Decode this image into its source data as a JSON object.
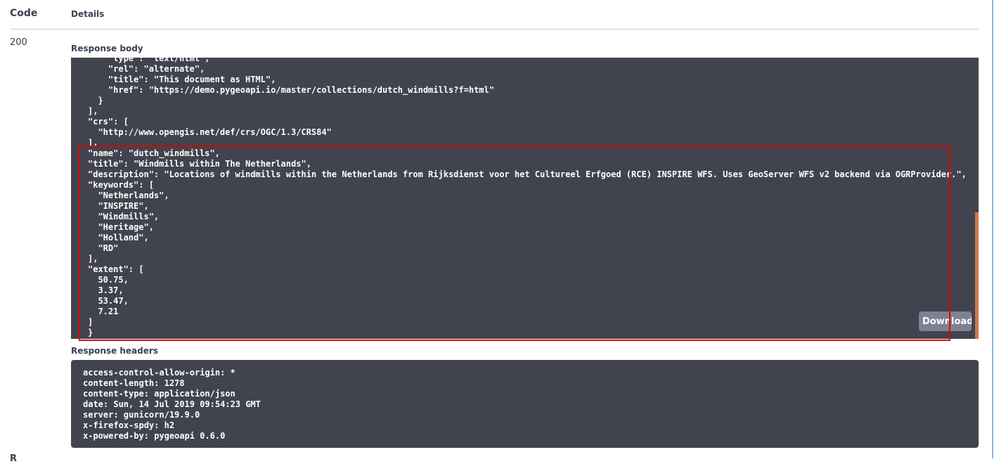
{
  "table": {
    "code_header": "Code",
    "details_header": "Details"
  },
  "response": {
    "code": "200",
    "body_label": "Response body",
    "body_text": "    \"type\": \"text/html\",\n    \"rel\": \"alternate\",\n    \"title\": \"This document as HTML\",\n    \"href\": \"https://demo.pygeoapi.io/master/collections/dutch_windmills?f=html\"\n  }\n],\n\"crs\": [\n  \"http://www.opengis.net/def/crs/OGC/1.3/CRS84\"\n],\n\"name\": \"dutch_windmills\",\n\"title\": \"Windmills within The Netherlands\",\n\"description\": \"Locations of windmills within the Netherlands from Rijksdienst voor het Cultureel Erfgoed (RCE) INSPIRE WFS. Uses GeoServer WFS v2 backend via OGRProvider.\",\n\"keywords\": [\n  \"Netherlands\",\n  \"INSPIRE\",\n  \"Windmills\",\n  \"Heritage\",\n  \"Holland\",\n  \"RD\"\n],\n\"extent\": [\n  50.75,\n  3.37,\n  53.47,\n  7.21\n]\n}",
    "download_label": "Download",
    "headers_label": "Response headers",
    "headers_text": "access-control-allow-origin: *\ncontent-length: 1278\ncontent-type: application/json\ndate: Sun, 14 Jul 2019 09:54:23 GMT\nserver: gunicorn/19.9.0\nx-firefox-spdy: h2\nx-powered-by: pygeoapi 0.6.0",
    "next_section_partial": "R"
  },
  "colors": {
    "code_bg": "#41444e",
    "highlight": "#e00000",
    "scrollbar": "#d0764a",
    "button": "#7d8293"
  }
}
